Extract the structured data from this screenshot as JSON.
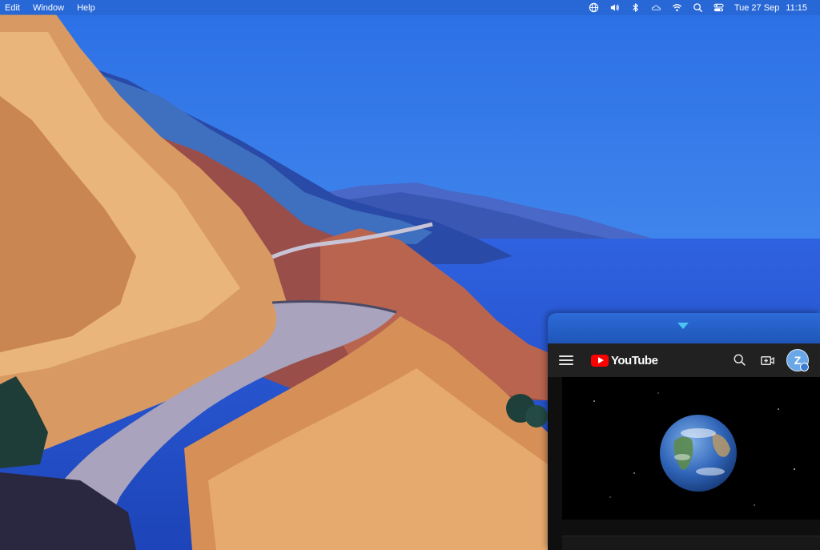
{
  "menubar": {
    "items": [
      "Edit",
      "Window",
      "Help"
    ],
    "status_icons": [
      "globe-icon",
      "volume-icon",
      "bluetooth-icon",
      "cloud-icon",
      "wifi-icon",
      "search-icon",
      "control-center-icon"
    ],
    "date": "Tue 27 Sep",
    "time": "11:15"
  },
  "youtube": {
    "logo_text": "YouTube",
    "avatar_letter": "Z",
    "header_icons": [
      "menu-icon",
      "search-icon",
      "create-video-icon"
    ],
    "brand_color": "#ff0000"
  }
}
